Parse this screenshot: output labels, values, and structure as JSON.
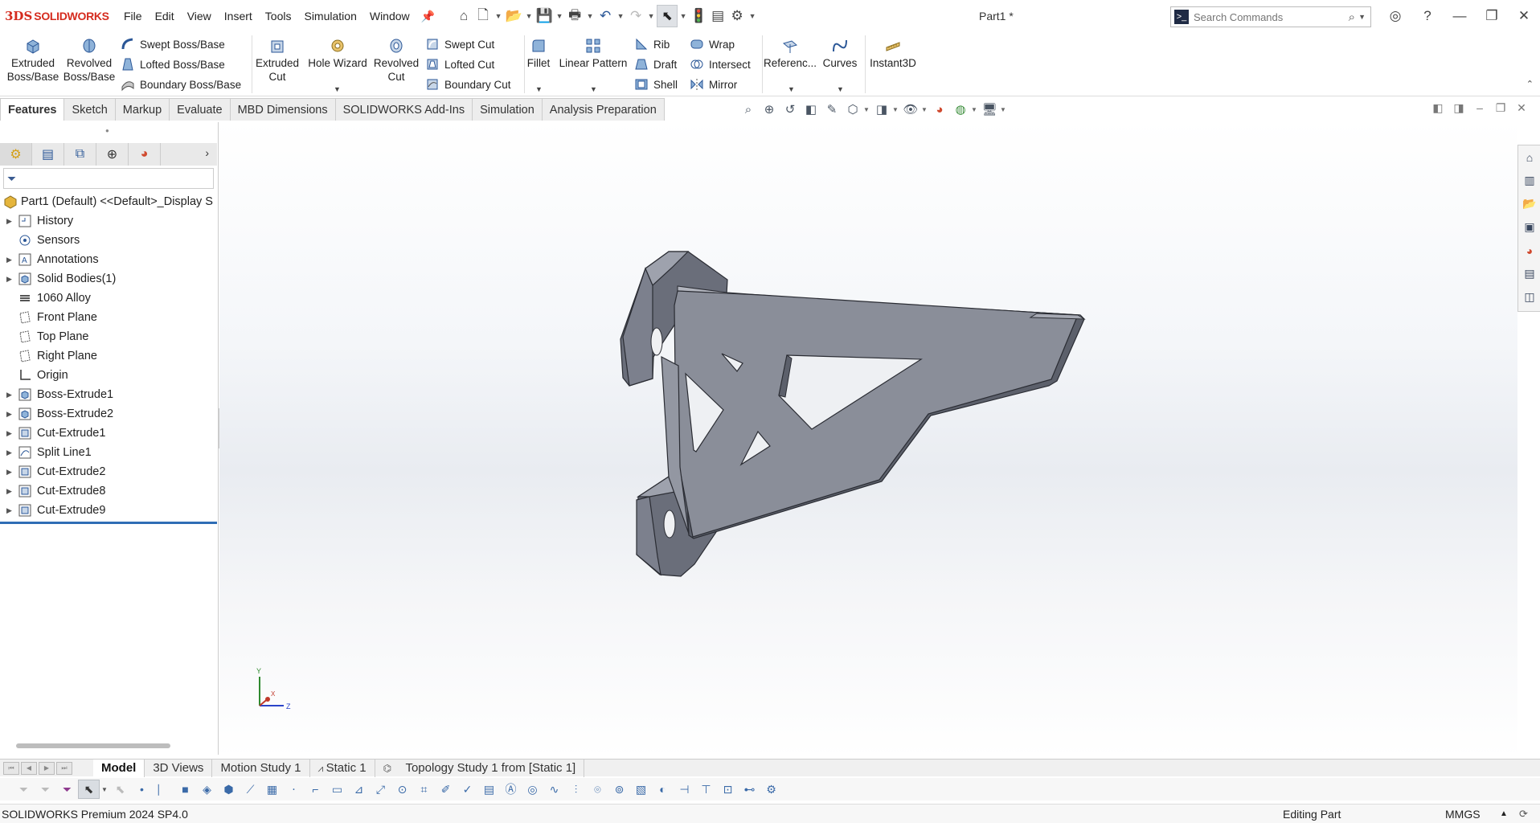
{
  "app": {
    "logo_ds": "3DS",
    "logo_text": "SOLIDWORKS",
    "document_title": "Part1 *"
  },
  "menu": [
    "File",
    "Edit",
    "View",
    "Insert",
    "Tools",
    "Simulation",
    "Window"
  ],
  "search": {
    "placeholder": "Search Commands"
  },
  "ribbon": {
    "extruded_boss": "Extruded Boss/Base",
    "revolved_boss": "Revolved Boss/Base",
    "swept_boss": "Swept Boss/Base",
    "lofted_boss": "Lofted Boss/Base",
    "boundary_boss": "Boundary Boss/Base",
    "extruded_cut": "Extruded Cut",
    "hole_wizard": "Hole Wizard",
    "revolved_cut": "Revolved Cut",
    "swept_cut": "Swept Cut",
    "lofted_cut": "Lofted Cut",
    "boundary_cut": "Boundary Cut",
    "fillet": "Fillet",
    "linear_pattern": "Linear Pattern",
    "rib": "Rib",
    "draft": "Draft",
    "shell": "Shell",
    "wrap": "Wrap",
    "intersect": "Intersect",
    "mirror": "Mirror",
    "reference": "Referenc...",
    "curves": "Curves",
    "instant3d": "Instant3D"
  },
  "tabs": [
    "Features",
    "Sketch",
    "Markup",
    "Evaluate",
    "MBD Dimensions",
    "SOLIDWORKS Add-Ins",
    "Simulation",
    "Analysis Preparation"
  ],
  "feature_tree": {
    "root": "Part1 (Default) <<Default>_Display S",
    "items": [
      {
        "label": "History",
        "icon": "history-icon",
        "expandable": true
      },
      {
        "label": "Sensors",
        "icon": "sensors-icon",
        "expandable": false
      },
      {
        "label": "Annotations",
        "icon": "annotations-icon",
        "expandable": true
      },
      {
        "label": "Solid Bodies(1)",
        "icon": "solid-bodies-icon",
        "expandable": true
      },
      {
        "label": "1060 Alloy",
        "icon": "material-icon",
        "expandable": false
      },
      {
        "label": "Front Plane",
        "icon": "plane-icon",
        "expandable": false
      },
      {
        "label": "Top Plane",
        "icon": "plane-icon",
        "expandable": false
      },
      {
        "label": "Right Plane",
        "icon": "plane-icon",
        "expandable": false
      },
      {
        "label": "Origin",
        "icon": "origin-icon",
        "expandable": false
      },
      {
        "label": "Boss-Extrude1",
        "icon": "boss-extrude-icon",
        "expandable": true
      },
      {
        "label": "Boss-Extrude2",
        "icon": "boss-extrude-icon",
        "expandable": true
      },
      {
        "label": "Cut-Extrude1",
        "icon": "cut-extrude-icon",
        "expandable": true
      },
      {
        "label": "Split Line1",
        "icon": "split-line-icon",
        "expandable": true
      },
      {
        "label": "Cut-Extrude2",
        "icon": "cut-extrude-icon",
        "expandable": true
      },
      {
        "label": "Cut-Extrude8",
        "icon": "cut-extrude-icon",
        "expandable": true
      },
      {
        "label": "Cut-Extrude9",
        "icon": "cut-extrude-icon",
        "expandable": true
      }
    ]
  },
  "triad": {
    "y": "Y",
    "x": "X",
    "z": "Z"
  },
  "bottom_tabs": [
    "Model",
    "3D Views",
    "Motion Study 1",
    "Static 1",
    "Topology Study 1 from [Static 1]"
  ],
  "status": {
    "product": "SOLIDWORKS Premium 2024 SP4.0",
    "mode": "Editing Part",
    "units": "MMGS"
  },
  "colors": {
    "brand_red": "#d52b1e",
    "part_gray": "#8a8e99",
    "selection_blue": "#2f6db5"
  }
}
